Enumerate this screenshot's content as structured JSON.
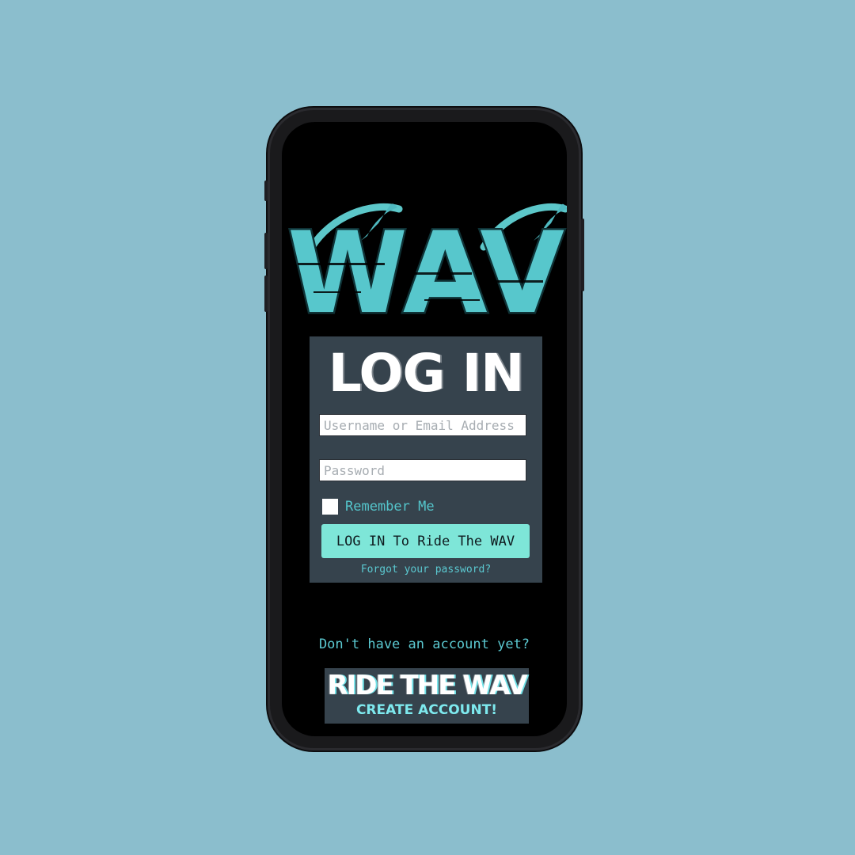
{
  "brand": {
    "logo_text": "WAV",
    "colors": {
      "background": "#8bbecd",
      "accent": "#57c7cc",
      "card": "#36434d",
      "button": "#7ee6d8"
    }
  },
  "login": {
    "title": "LOG IN",
    "username_placeholder": "Username or Email Address",
    "password_placeholder": "Password",
    "remember_label": "Remember Me",
    "remember_checked": false,
    "submit_label": "LOG IN To Ride The WAV",
    "forgot_link": "Forgot your password?"
  },
  "signup": {
    "prompt": "Don't have an account yet?",
    "button_title": "RIDE THE WAV",
    "button_subtitle": "CREATE ACCOUNT!"
  }
}
